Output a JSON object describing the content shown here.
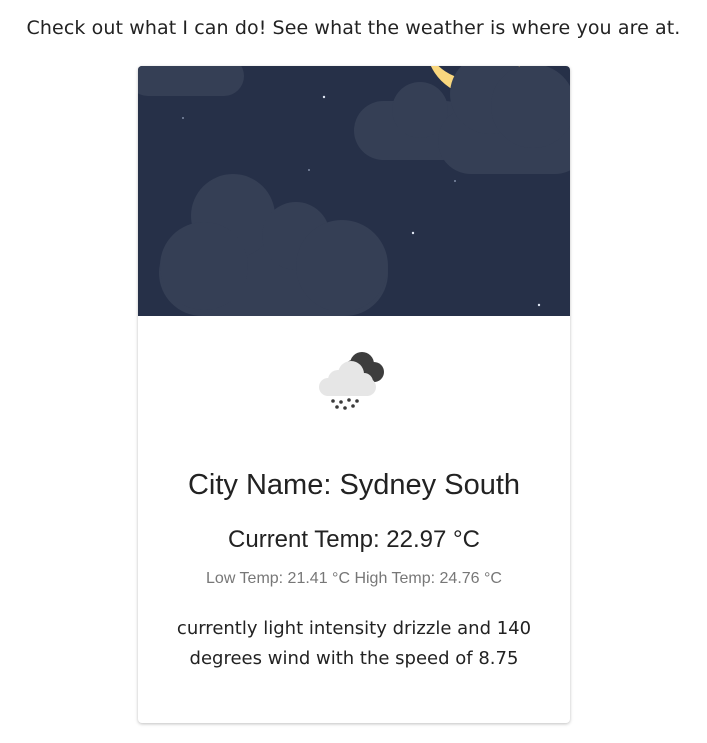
{
  "intro": {
    "text": "Check out what I can do! See what the weather is where you are at."
  },
  "card": {
    "image_icon": "night-clouds-moon-illustration",
    "weather_icon": "light-drizzle-cloud-icon",
    "city_line": "City Name: Sydney South",
    "current_temp_line": "Current Temp: 22.97 °C",
    "low_high_line": "Low Temp: 21.41 °C High Temp: 24.76 °C",
    "description": "currently light intensity drizzle and 140 degrees wind with the speed of 8.75"
  },
  "colors": {
    "sky": "#263048",
    "cloud": "#353f55",
    "moon": "#f9d77e",
    "text": "#222222",
    "muted_text": "#777777"
  }
}
